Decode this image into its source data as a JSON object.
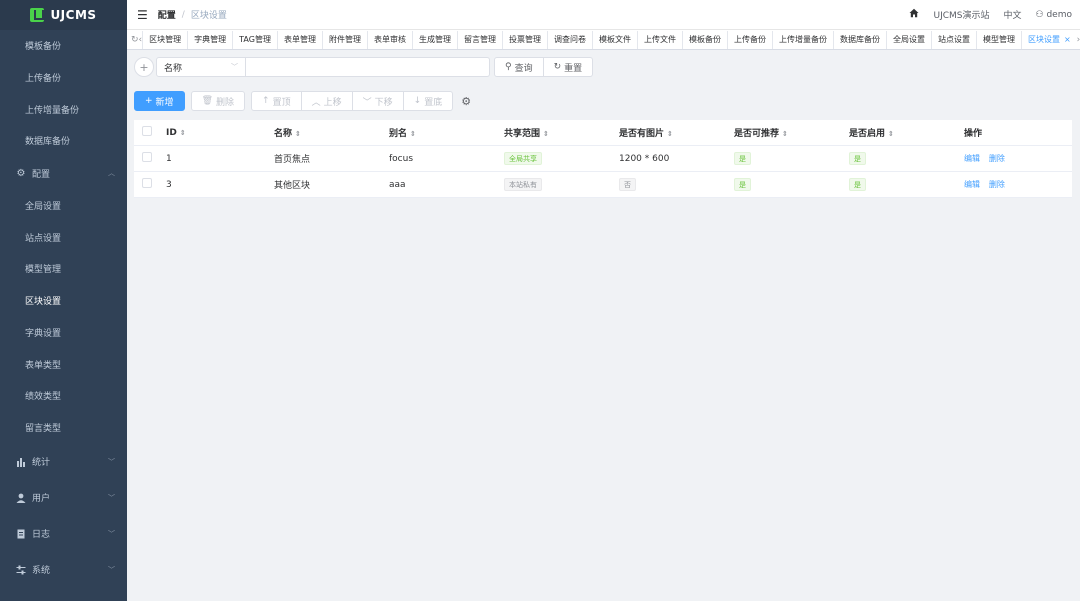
{
  "app": {
    "logo_text": "UJCMS"
  },
  "sidebar": {
    "top_items": [
      {
        "label": "模板备份"
      },
      {
        "label": "上传备份"
      },
      {
        "label": "上传增量备份"
      },
      {
        "label": "数据库备份"
      }
    ],
    "config_group": {
      "label": "配置"
    },
    "config_items": [
      {
        "label": "全局设置"
      },
      {
        "label": "站点设置"
      },
      {
        "label": "模型管理"
      },
      {
        "label": "区块设置"
      },
      {
        "label": "字典设置"
      },
      {
        "label": "表单类型"
      },
      {
        "label": "绩效类型"
      },
      {
        "label": "留言类型"
      }
    ],
    "groups": [
      {
        "label": "统计"
      },
      {
        "label": "用户"
      },
      {
        "label": "日志"
      },
      {
        "label": "系统"
      }
    ]
  },
  "header": {
    "breadcrumb_root": "配置",
    "breadcrumb_separator": "/",
    "breadcrumb_current": "区块设置",
    "site_label": "UJCMS演示站",
    "language": "中文",
    "user": "demo"
  },
  "tags": [
    "区块管理",
    "字典管理",
    "TAG管理",
    "表单管理",
    "附件管理",
    "表单审核",
    "生成管理",
    "留言管理",
    "投票管理",
    "调查问卷",
    "模板文件",
    "上传文件",
    "模板备份",
    "上传备份",
    "上传增量备份",
    "数据库备份",
    "全局设置",
    "站点设置",
    "模型管理",
    "区块设置"
  ],
  "search": {
    "field_select": "名称",
    "query_button": "查询",
    "reset_button": "重置"
  },
  "toolbar": {
    "add": "新增",
    "delete": "删除",
    "top": "置顶",
    "up": "上移",
    "down": "下移",
    "bottom": "置底"
  },
  "table": {
    "columns": [
      "ID",
      "名称",
      "别名",
      "共享范围",
      "是否有图片",
      "是否可推荐",
      "是否启用",
      "操作"
    ],
    "rows": [
      {
        "id": "1",
        "name": "首页焦点",
        "alias": "focus",
        "share": "全局共享",
        "image": "1200 * 600",
        "recommendable": "是",
        "enabled": "是"
      },
      {
        "id": "3",
        "name": "其他区块",
        "alias": "aaa",
        "share": "本站私有",
        "image": "否",
        "recommendable": "是",
        "enabled": "是"
      }
    ],
    "edit_label": "编辑",
    "delete_label": "删除"
  },
  "colors": {
    "sidebar_bg": "#304156",
    "primary": "#409eff",
    "success": "#67c23a",
    "logo_green": "#4ad24a"
  }
}
